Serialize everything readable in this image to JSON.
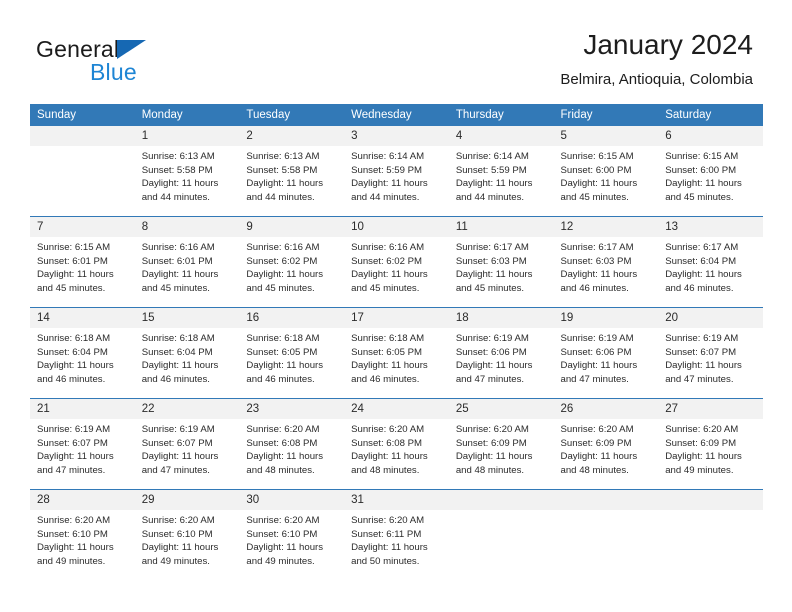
{
  "brand": {
    "name_top": "General",
    "name_bottom": "Blue",
    "triangle_color": "#1668b3",
    "blue_color": "#1e85d4"
  },
  "header": {
    "title": "January 2024",
    "subtitle": "Belmira, Antioquia, Colombia"
  },
  "theme": {
    "header_bg": "#3279b7",
    "daynum_bg": "#f2f2f2",
    "text": "#2b2b2b",
    "rule": "#3279b7"
  },
  "weekday_headers": [
    "Sunday",
    "Monday",
    "Tuesday",
    "Wednesday",
    "Thursday",
    "Friday",
    "Saturday"
  ],
  "labels": {
    "sunrise_prefix": "Sunrise:",
    "sunset_prefix": "Sunset:",
    "daylight_prefix": "Daylight:"
  },
  "weeks": [
    [
      {
        "day": "",
        "lines": []
      },
      {
        "day": "1",
        "lines": [
          "Sunrise: 6:13 AM",
          "Sunset: 5:58 PM",
          "Daylight: 11 hours",
          "and 44 minutes."
        ]
      },
      {
        "day": "2",
        "lines": [
          "Sunrise: 6:13 AM",
          "Sunset: 5:58 PM",
          "Daylight: 11 hours",
          "and 44 minutes."
        ]
      },
      {
        "day": "3",
        "lines": [
          "Sunrise: 6:14 AM",
          "Sunset: 5:59 PM",
          "Daylight: 11 hours",
          "and 44 minutes."
        ]
      },
      {
        "day": "4",
        "lines": [
          "Sunrise: 6:14 AM",
          "Sunset: 5:59 PM",
          "Daylight: 11 hours",
          "and 44 minutes."
        ]
      },
      {
        "day": "5",
        "lines": [
          "Sunrise: 6:15 AM",
          "Sunset: 6:00 PM",
          "Daylight: 11 hours",
          "and 45 minutes."
        ]
      },
      {
        "day": "6",
        "lines": [
          "Sunrise: 6:15 AM",
          "Sunset: 6:00 PM",
          "Daylight: 11 hours",
          "and 45 minutes."
        ]
      }
    ],
    [
      {
        "day": "7",
        "lines": [
          "Sunrise: 6:15 AM",
          "Sunset: 6:01 PM",
          "Daylight: 11 hours",
          "and 45 minutes."
        ]
      },
      {
        "day": "8",
        "lines": [
          "Sunrise: 6:16 AM",
          "Sunset: 6:01 PM",
          "Daylight: 11 hours",
          "and 45 minutes."
        ]
      },
      {
        "day": "9",
        "lines": [
          "Sunrise: 6:16 AM",
          "Sunset: 6:02 PM",
          "Daylight: 11 hours",
          "and 45 minutes."
        ]
      },
      {
        "day": "10",
        "lines": [
          "Sunrise: 6:16 AM",
          "Sunset: 6:02 PM",
          "Daylight: 11 hours",
          "and 45 minutes."
        ]
      },
      {
        "day": "11",
        "lines": [
          "Sunrise: 6:17 AM",
          "Sunset: 6:03 PM",
          "Daylight: 11 hours",
          "and 45 minutes."
        ]
      },
      {
        "day": "12",
        "lines": [
          "Sunrise: 6:17 AM",
          "Sunset: 6:03 PM",
          "Daylight: 11 hours",
          "and 46 minutes."
        ]
      },
      {
        "day": "13",
        "lines": [
          "Sunrise: 6:17 AM",
          "Sunset: 6:04 PM",
          "Daylight: 11 hours",
          "and 46 minutes."
        ]
      }
    ],
    [
      {
        "day": "14",
        "lines": [
          "Sunrise: 6:18 AM",
          "Sunset: 6:04 PM",
          "Daylight: 11 hours",
          "and 46 minutes."
        ]
      },
      {
        "day": "15",
        "lines": [
          "Sunrise: 6:18 AM",
          "Sunset: 6:04 PM",
          "Daylight: 11 hours",
          "and 46 minutes."
        ]
      },
      {
        "day": "16",
        "lines": [
          "Sunrise: 6:18 AM",
          "Sunset: 6:05 PM",
          "Daylight: 11 hours",
          "and 46 minutes."
        ]
      },
      {
        "day": "17",
        "lines": [
          "Sunrise: 6:18 AM",
          "Sunset: 6:05 PM",
          "Daylight: 11 hours",
          "and 46 minutes."
        ]
      },
      {
        "day": "18",
        "lines": [
          "Sunrise: 6:19 AM",
          "Sunset: 6:06 PM",
          "Daylight: 11 hours",
          "and 47 minutes."
        ]
      },
      {
        "day": "19",
        "lines": [
          "Sunrise: 6:19 AM",
          "Sunset: 6:06 PM",
          "Daylight: 11 hours",
          "and 47 minutes."
        ]
      },
      {
        "day": "20",
        "lines": [
          "Sunrise: 6:19 AM",
          "Sunset: 6:07 PM",
          "Daylight: 11 hours",
          "and 47 minutes."
        ]
      }
    ],
    [
      {
        "day": "21",
        "lines": [
          "Sunrise: 6:19 AM",
          "Sunset: 6:07 PM",
          "Daylight: 11 hours",
          "and 47 minutes."
        ]
      },
      {
        "day": "22",
        "lines": [
          "Sunrise: 6:19 AM",
          "Sunset: 6:07 PM",
          "Daylight: 11 hours",
          "and 47 minutes."
        ]
      },
      {
        "day": "23",
        "lines": [
          "Sunrise: 6:20 AM",
          "Sunset: 6:08 PM",
          "Daylight: 11 hours",
          "and 48 minutes."
        ]
      },
      {
        "day": "24",
        "lines": [
          "Sunrise: 6:20 AM",
          "Sunset: 6:08 PM",
          "Daylight: 11 hours",
          "and 48 minutes."
        ]
      },
      {
        "day": "25",
        "lines": [
          "Sunrise: 6:20 AM",
          "Sunset: 6:09 PM",
          "Daylight: 11 hours",
          "and 48 minutes."
        ]
      },
      {
        "day": "26",
        "lines": [
          "Sunrise: 6:20 AM",
          "Sunset: 6:09 PM",
          "Daylight: 11 hours",
          "and 48 minutes."
        ]
      },
      {
        "day": "27",
        "lines": [
          "Sunrise: 6:20 AM",
          "Sunset: 6:09 PM",
          "Daylight: 11 hours",
          "and 49 minutes."
        ]
      }
    ],
    [
      {
        "day": "28",
        "lines": [
          "Sunrise: 6:20 AM",
          "Sunset: 6:10 PM",
          "Daylight: 11 hours",
          "and 49 minutes."
        ]
      },
      {
        "day": "29",
        "lines": [
          "Sunrise: 6:20 AM",
          "Sunset: 6:10 PM",
          "Daylight: 11 hours",
          "and 49 minutes."
        ]
      },
      {
        "day": "30",
        "lines": [
          "Sunrise: 6:20 AM",
          "Sunset: 6:10 PM",
          "Daylight: 11 hours",
          "and 49 minutes."
        ]
      },
      {
        "day": "31",
        "lines": [
          "Sunrise: 6:20 AM",
          "Sunset: 6:11 PM",
          "Daylight: 11 hours",
          "and 50 minutes."
        ]
      },
      {
        "day": "",
        "lines": []
      },
      {
        "day": "",
        "lines": []
      },
      {
        "day": "",
        "lines": []
      }
    ]
  ]
}
